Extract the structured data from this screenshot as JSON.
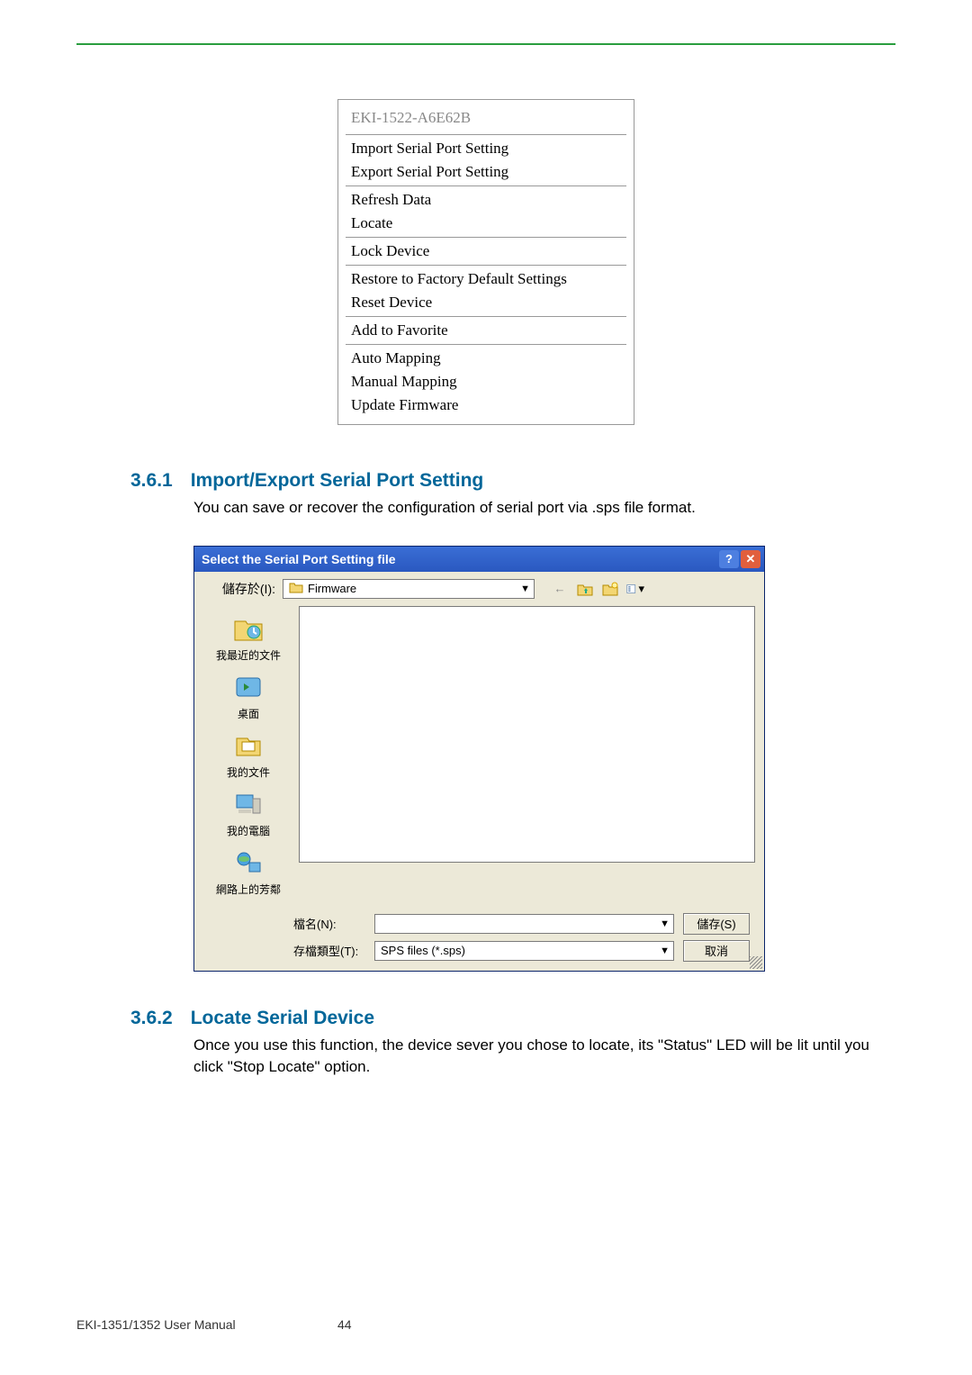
{
  "context_menu": {
    "title": "EKI-1522-A6E62B",
    "groups": [
      [
        "Import Serial Port Setting",
        "Export Serial Port Setting"
      ],
      [
        "Refresh Data",
        "Locate"
      ],
      [
        "Lock Device"
      ],
      [
        "Restore to Factory Default Settings",
        "Reset Device"
      ],
      [
        "Add to Favorite"
      ],
      [
        "Auto Mapping",
        "Manual Mapping",
        "Update Firmware"
      ]
    ]
  },
  "section1": {
    "number": "3.6.1",
    "title": "Import/Export Serial Port Setting",
    "text": "You can save or recover the configuration of serial port via .sps file format."
  },
  "dialog": {
    "title": "Select the Serial Port Setting file",
    "save_in_label": "儲存於(I):",
    "folder_name": "Firmware",
    "sidebar": [
      "我最近的文件",
      "桌面",
      "我的文件",
      "我的電腦",
      "網路上的芳鄰"
    ],
    "filename_label": "檔名(N):",
    "filename_value": "",
    "filetype_label": "存檔類型(T):",
    "filetype_value": "SPS files (*.sps)",
    "save_btn": "儲存(S)",
    "cancel_btn": "取消"
  },
  "section2": {
    "number": "3.6.2",
    "title": "Locate Serial Device",
    "text": "Once you use this function, the device sever you chose to locate, its \"Status\" LED will be lit until you click \"Stop Locate\" option."
  },
  "footer": {
    "manual": "EKI-1351/1352 User Manual",
    "page": "44"
  }
}
